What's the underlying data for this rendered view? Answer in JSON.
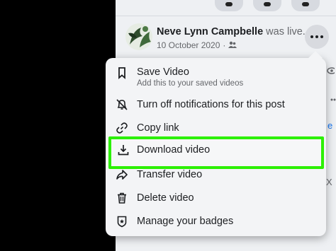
{
  "post": {
    "author": "Neve Lynn Campbelle",
    "action": " was live.",
    "date": "10 October 2020",
    "audience_icon": "friends-icon",
    "more_icon": "more-options-icon"
  },
  "menu": {
    "items": [
      {
        "label": "Save Video",
        "sublabel": "Add this to your saved videos",
        "icon": "bookmark-icon"
      },
      {
        "label": "Turn off notifications for this post",
        "icon": "bell-off-icon"
      },
      {
        "label": "Copy link",
        "icon": "link-icon"
      },
      {
        "label": "Download video",
        "icon": "download-icon",
        "highlighted": true
      },
      {
        "label": "Transfer video",
        "icon": "share-arrow-icon"
      },
      {
        "label": "Delete video",
        "icon": "trash-icon"
      },
      {
        "label": "Manage your badges",
        "icon": "badge-icon"
      }
    ]
  },
  "colors": {
    "highlight": "#2cf000",
    "menu_background": "#f3f4f6",
    "text": "#1c1e21",
    "secondary_text": "#65676b"
  }
}
